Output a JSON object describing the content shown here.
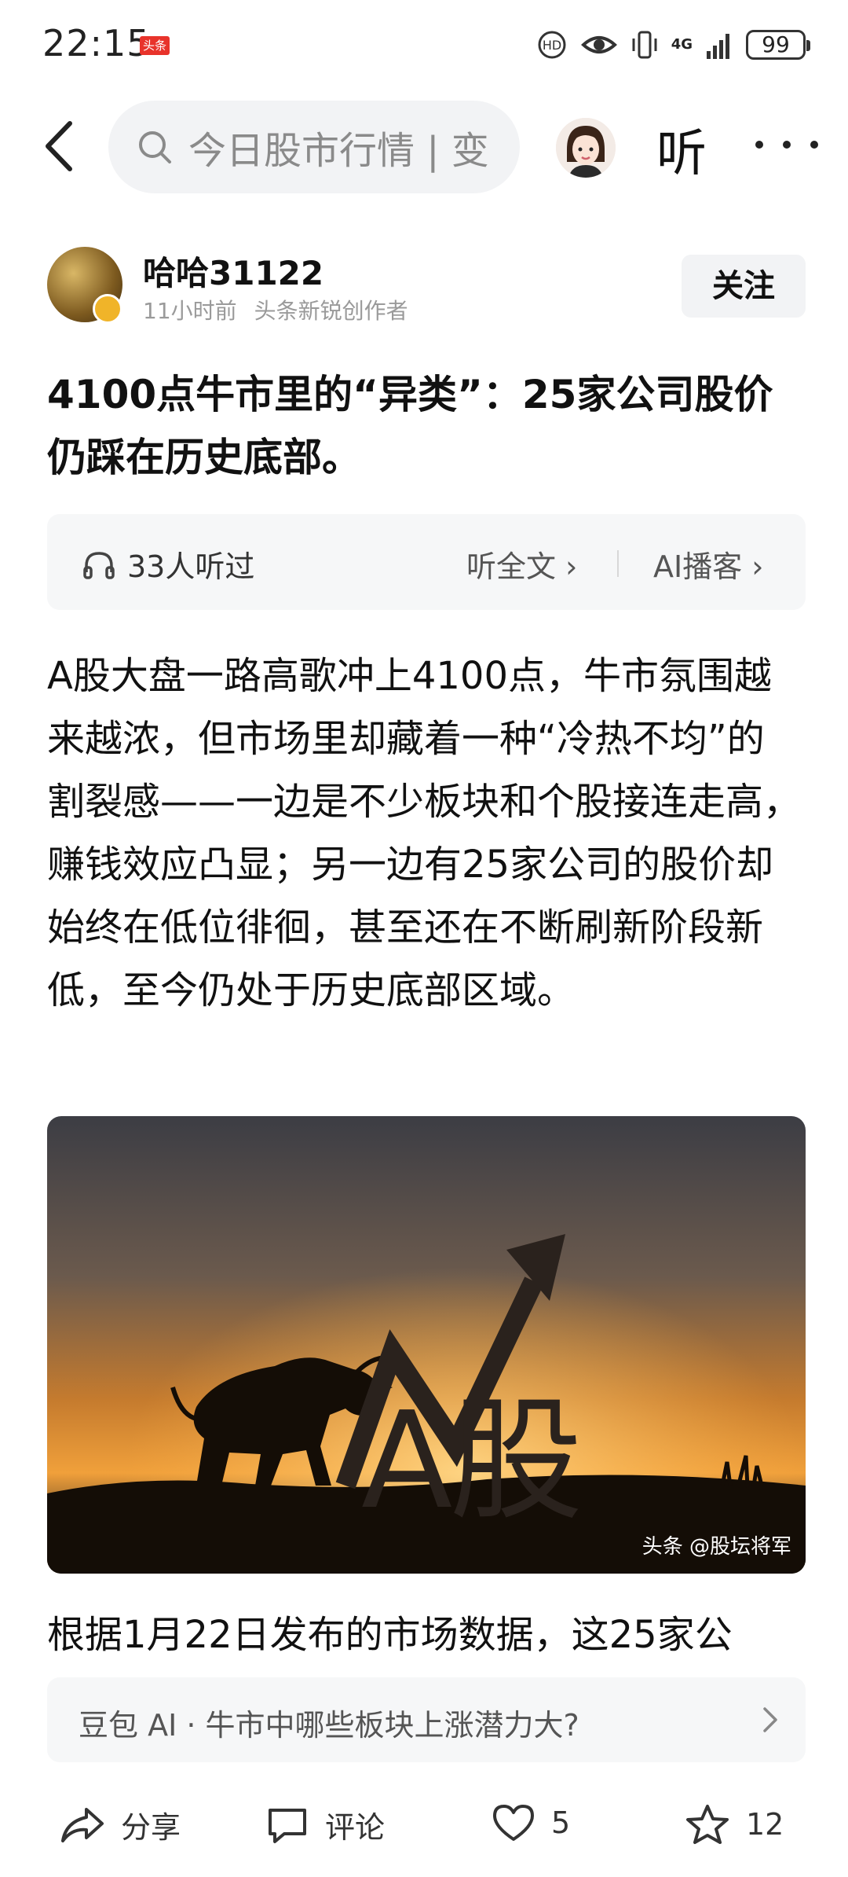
{
  "status_bar": {
    "time": "22:15",
    "app_badge": "头条",
    "network": "4G",
    "battery": "99",
    "icons": [
      "hd-call-icon",
      "eye-icon",
      "vibrate-icon",
      "signal-icon",
      "battery-icon"
    ]
  },
  "nav": {
    "search_placeholder": "今日股市行情 | 变",
    "listen_label": "听",
    "icons": [
      "back-arrow-icon",
      "search-icon",
      "avatar",
      "more-icon"
    ]
  },
  "author": {
    "name": "哈哈31122",
    "time_ago": "11小时前",
    "tag": "头条新锐创作者",
    "follow_label": "关注"
  },
  "article": {
    "title": "4100点牛市里的“异类”：25家公司股价仍踩在历史底部。",
    "listen_count": "33人听过",
    "listen_full": "听全文",
    "ai_podcast": "AI播客",
    "para1": "A股大盘一路高歌冲上4100点，牛市氛围越来越浓，但市场里却藏着一种“冷热不均”的割裂感——一边是不少板块和个股接连走高，赚钱效应凸显；另一边有25家公司的股价却始终在低位徘徊，甚至还在不断刷新阶段新低，至今仍处于历史底部区域。",
    "image_text": "A股",
    "image_caption": "头条 @股坛将军",
    "para2": "根据1月22日发布的市场数据，这25家公"
  },
  "ai_suggestion": {
    "text": "豆包 AI · 牛市中哪些板块上涨潜力大?"
  },
  "bottom_bar": {
    "share_label": "分享",
    "comment_label": "评论",
    "like_count": "5",
    "favorite_count": "12"
  },
  "colors": {
    "accent_red": "#e8332b",
    "panel_gray": "#f2f3f5",
    "text_gray": "#9a9a9a"
  }
}
